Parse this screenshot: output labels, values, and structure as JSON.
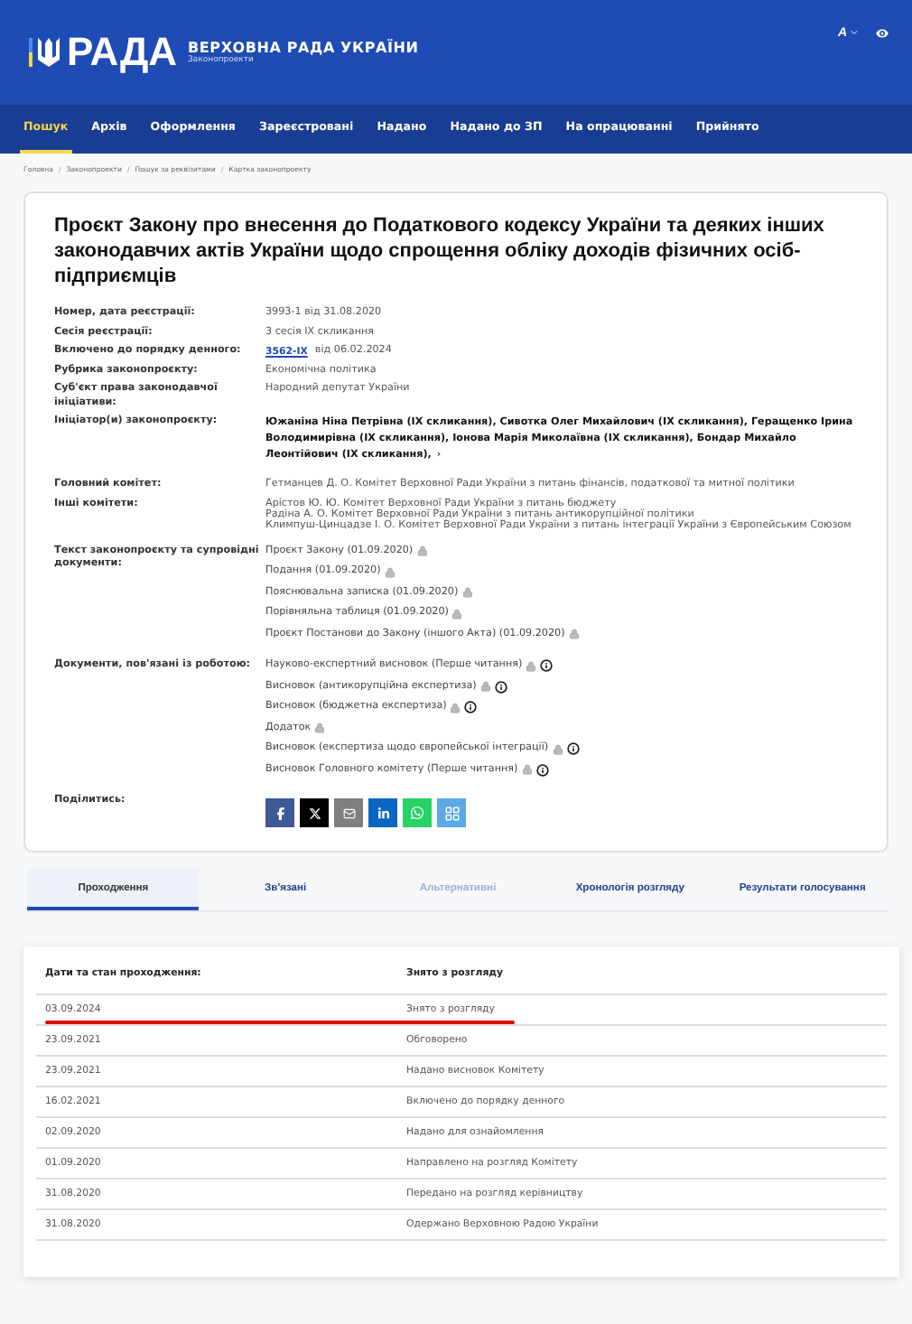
{
  "header": {
    "logo_text": "РАДА",
    "title": "ВЕРХОВНА РАДА УКРАЇНИ",
    "subtitle": "Законопроекти",
    "font_button": "A"
  },
  "nav": [
    {
      "label": "Пошук",
      "selected": true
    },
    {
      "label": "Архів",
      "selected": false
    },
    {
      "label": "Оформлення",
      "selected": false
    },
    {
      "label": "Зареєстровані",
      "selected": false
    },
    {
      "label": "Надано",
      "selected": false
    },
    {
      "label": "Надано до ЗП",
      "selected": false
    },
    {
      "label": "На опрацюванні",
      "selected": false
    },
    {
      "label": "Прийнято",
      "selected": false
    }
  ],
  "breadcrumbs": [
    {
      "label": "Головна"
    },
    {
      "separator": "/",
      "label": "Законопроекти"
    },
    {
      "separator": "/",
      "label": "Пошук за реквізитами"
    },
    {
      "separator": "/",
      "label": "Картка законопроекту"
    }
  ],
  "bill": {
    "title": "Проєкт Закону про внесення до Податкового кодексу України та деяких інших законодавчих актів України щодо спрощення обліку доходів фізичних осіб-підприємців",
    "fields": [
      {
        "label": "Номер, дата реєстрації:",
        "kind": "text",
        "value": "3993-1 від 31.08.2020"
      },
      {
        "label": "Сесія реєстрації:",
        "kind": "text",
        "value": "3 сесія IX скликання"
      },
      {
        "label": "Включено до порядку денного:",
        "kind": "link",
        "link": "3562-IX",
        "value": "від 06.02.2024"
      },
      {
        "label": "Рубрика законопроєкту:",
        "kind": "text",
        "value": "Економічна політика"
      },
      {
        "label": "Суб'єкт права законодавчої ініціативи:",
        "kind": "text",
        "value": "Народний депутат України"
      },
      {
        "label": "Ініціатор(и) законопроєкту:",
        "kind": "bold",
        "value": "Южаніна Ніна Петрівна (IX скликання), Сивотка Олег Михайлович (IX скликання), Геращенко Ірина Володимирівна (IX скликання), Іонова Марія Миколаївна (IX скликання), Бондар Михайло Леонтійович (IX скликання),",
        "more": "›"
      },
      {
        "label": "Головний комітет:",
        "kind": "text",
        "value": "Гетманцев Д. О. Комітет Верховної Ради України з питань фінансів, податкової та митної політики"
      },
      {
        "label": "Інші комітети:",
        "kind": "lines",
        "lines": [
          "Арістов Ю. Ю. Комітет Верховної Ради України з питань бюджету",
          "Радіна А. О. Комітет Верховної Ради України з питань антикорупційної політики",
          "Климпуш-Цинцадзе І. О. Комітет Верховної Ради України з питань інтеграції України з Європейським Союзом"
        ]
      },
      {
        "label": "Текст законопроєкту та супровідні документи:",
        "kind": "docs",
        "docs": [
          {
            "name": "Проєкт Закону (01.09.2020)",
            "locked": true,
            "info": false
          },
          {
            "name": "Подання (01.09.2020)",
            "locked": true,
            "info": false
          },
          {
            "name": "Пояснювальна записка (01.09.2020)",
            "locked": true,
            "info": false
          },
          {
            "name": "Порівняльна таблиця (01.09.2020)",
            "locked": true,
            "info": false
          },
          {
            "name": "Проєкт Постанови до Закону (іншого Акта) (01.09.2020)",
            "locked": true,
            "info": false
          }
        ]
      },
      {
        "label": "Документи, пов'язані із роботою:",
        "kind": "docs",
        "docs": [
          {
            "name": "Науково-експертний висновок (Перше читання)",
            "locked": true,
            "info": true
          },
          {
            "name": "Висновок (антикорупційна експертиза)",
            "locked": true,
            "info": true
          },
          {
            "name": "Висновок (бюджетна експертиза)",
            "locked": true,
            "info": true
          },
          {
            "name": "Додаток",
            "locked": true,
            "info": false
          },
          {
            "name": "Висновок (експертиза щодо європейської інтеграції)",
            "locked": true,
            "info": true
          },
          {
            "name": "Висновок Головного комітету (Перше читання)",
            "locked": true,
            "info": true
          }
        ]
      },
      {
        "label": "Поділитись:",
        "kind": "share",
        "buttons": [
          {
            "kind": "facebook",
            "color": "#3b5998"
          },
          {
            "kind": "x",
            "color": "#000000"
          },
          {
            "kind": "email",
            "color": "#7f7f7f"
          },
          {
            "kind": "linkedin",
            "color": "#0a66c2"
          },
          {
            "kind": "whatsapp",
            "color": "#25d366"
          },
          {
            "kind": "grid",
            "color": "#5aa9e6"
          }
        ]
      }
    ]
  },
  "tabs": [
    {
      "label": "Проходження",
      "selected": true,
      "disabled": false
    },
    {
      "label": "Зв'язані",
      "selected": false,
      "disabled": false
    },
    {
      "label": "Альтернативні",
      "selected": false,
      "disabled": true
    },
    {
      "label": "Хронологія розгляду",
      "selected": false,
      "disabled": false
    },
    {
      "label": "Результати голосування",
      "selected": false,
      "disabled": false
    }
  ],
  "passage": {
    "columns": [
      "Дати та стан проходження:",
      "Знято з розгляду"
    ],
    "rows": [
      {
        "date": "03.09.2024",
        "status": "Знято з розгляду",
        "underlined": true
      },
      {
        "date": "23.09.2021",
        "status": "Обговорено",
        "underlined": false
      },
      {
        "date": "23.09.2021",
        "status": "Надано висновок Комітету",
        "underlined": false
      },
      {
        "date": "16.02.2021",
        "status": "Включено до порядку денного",
        "underlined": false
      },
      {
        "date": "02.09.2020",
        "status": "Надано для ознайомлення",
        "underlined": false
      },
      {
        "date": "01.09.2020",
        "status": "Направлено на розгляд Комітету",
        "underlined": false
      },
      {
        "date": "31.08.2020",
        "status": "Передано на розгляд керівництву",
        "underlined": false
      },
      {
        "date": "31.08.2020",
        "status": "Одержано Верховною Радою України",
        "underlined": false
      }
    ]
  }
}
